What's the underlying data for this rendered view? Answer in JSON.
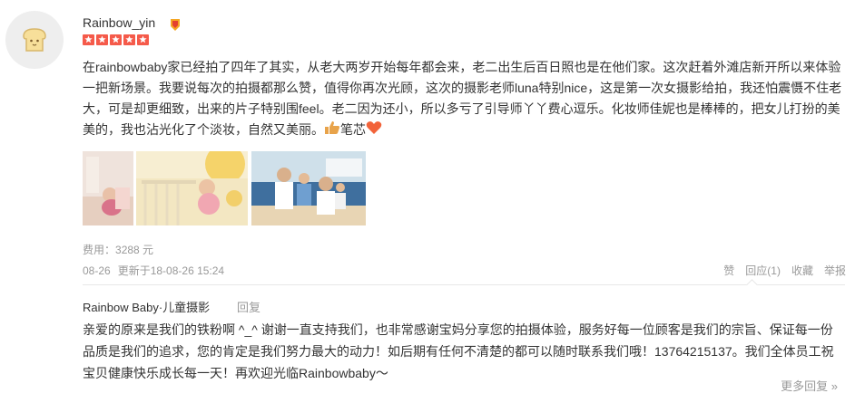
{
  "user": {
    "name": "Rainbow_yin",
    "avatar_icon": "toast-bread-icon",
    "badge_icon": "vip-badge-icon",
    "rating_stars": 5
  },
  "review": {
    "text": "在rainbowbaby家已经拍了四年了其实，从老大两岁开始每年都会来，老二出生后百日照也是在他们家。这次赶着外滩店新开所以来体验一把新场景。我要说每次的拍摄都那么赞，值得你再次光顾，这次的摄影老师luna特别nice，这是第一次女摄影给拍，我还怕震慑不住老大，可是却更细致，出来的片子特别围feel。老二因为还小，所以多亏了引导师丫丫费心逗乐。化妆师佳妮也是棒棒的，把女儿打扮的美美的，我也沾光化了个淡妆，自然又美丽。",
    "emoji_text": "笔芯",
    "emoji_icons": [
      "thumbs-up-icon",
      "heart-icon"
    ]
  },
  "photos": [
    {
      "name": "photo-baby-pink",
      "colors": [
        "#f3d9d0",
        "#caa7a0"
      ]
    },
    {
      "name": "photo-baby-crib",
      "colors": [
        "#f4e6b8",
        "#d9c88a"
      ]
    },
    {
      "name": "photo-family",
      "colors": [
        "#5f8fb8",
        "#f0d9b8"
      ]
    }
  ],
  "fee": {
    "label": "费用：",
    "value": "3288 元"
  },
  "meta": {
    "date": "08-26",
    "updated": "更新于18-08-26 15:24"
  },
  "actions": {
    "like": "赞",
    "reply": "回应(1)",
    "favorite": "收藏",
    "report": "举报"
  },
  "shop_reply": {
    "shop_name": "Rainbow Baby·儿童摄影",
    "reply_label": "回复",
    "text": "亲爱的原来是我们的铁粉啊 ^_^ 谢谢一直支持我们，也非常感谢宝妈分享您的拍摄体验，服务好每一位顾客是我们的宗旨、保证每一份品质是我们的追求，您的肯定是我们努力最大的动力！如后期有任何不清楚的都可以随时联系我们哦！13764215137。我们全体员工祝宝贝健康快乐成长每一天！再欢迎光临Rainbowbaby～",
    "more": "更多回复 »"
  },
  "colors": {
    "star": "#f55a4a",
    "heart": "#f2633a",
    "thumb": "#e8a34a"
  }
}
